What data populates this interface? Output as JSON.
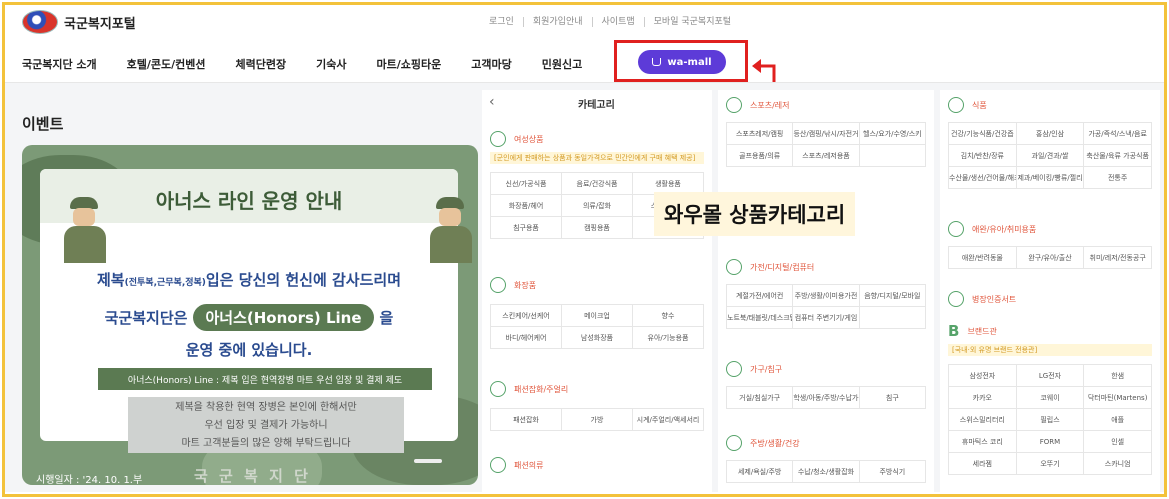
{
  "header": {
    "logo_text": "국군복지포털",
    "utility_links": [
      "로그인",
      "회원가입안내",
      "사이트맵",
      "모바일 국군복지포털"
    ]
  },
  "nav": {
    "items": [
      "국군복지단 소개",
      "호텔/콘도/컨벤션",
      "체력단련장",
      "기숙사",
      "마트/쇼핑타운",
      "고객마당",
      "민원신고"
    ],
    "wamall_label": "wa-mall"
  },
  "event": {
    "title": "이벤트",
    "banner": {
      "heading": "아너스 라인 운영 안내",
      "line1_a": "제복",
      "line1_small": "(전투복,근무복,정복)",
      "line1_b": "입은 당신의 헌신에 감사드리며",
      "line2_a": "국군복지단은",
      "honors": "아너스(Honors) Line",
      "line2_b": "을",
      "line3": "운영 중에 있습니다.",
      "bar": "아너스(Honors) Line : 제복 입은 현역장병 마트 우선 입장 및 결제 제도",
      "note1": "제복을 착용한 현역 장병은 본인에 한해서만",
      "note2": "우선 입장 및 결제가 가능하니",
      "note3": "마트 고객분들의 많은 양해 부탁드립니다",
      "date": "시행일자 : '24. 10. 1.부",
      "org": "국 군 복 지 단"
    }
  },
  "category_panel": {
    "title": "카테고리",
    "sections": [
      {
        "title": "여성상품",
        "sub": "[군인에게 판매하는 상품과 동일가격으로 민간인에게 구매 혜택 제공]",
        "items": [
          "신선/가공식품",
          "음료/건강식품",
          "생활용품",
          "화장품/헤어",
          "의류/잡화",
          "스포츠/레저",
          "침구용품",
          "캠핑용품"
        ]
      },
      {
        "title": "화장품",
        "items": [
          "스킨케어/선케어",
          "메이크업",
          "향수",
          "바디/헤어케어",
          "남성화장품",
          "유아/기능용품"
        ]
      },
      {
        "title": "패션잡화/주얼리",
        "items": [
          "패션잡화",
          "가방",
          "시계/주얼리/액세서리"
        ]
      },
      {
        "title": "패션의류",
        "items": []
      }
    ]
  },
  "category_panel_2": {
    "sections": [
      {
        "title": "스포츠/레저",
        "items": [
          "스포츠레저/캠핑",
          "등산/캠핑/낚시/자전거",
          "헬스/요가/수영/스키",
          "골프용품/의류",
          "스포츠/레저용품"
        ]
      },
      {
        "title": "가전/디지털/컴퓨터",
        "items": [
          "계절가전/에어컨",
          "주방/생활/이미용가전",
          "음향/디지털/모바일",
          "노트북/태블릿/데스크탑",
          "컴퓨터 주변기기/게임"
        ]
      },
      {
        "title": "가구/침구",
        "items": [
          "거실/침실가구",
          "학생/아동/주방/수납가구",
          "침구"
        ]
      },
      {
        "title": "주방/생활/건강",
        "items": [
          "세제/욕실/주방",
          "수납/청소/생활잡화",
          "주방식기"
        ]
      }
    ]
  },
  "category_panel_3": {
    "sections": [
      {
        "title": "식품",
        "items": [
          "건강/기능식품/건강즙",
          "홍삼/인삼",
          "가공/즉석/스낵/음료",
          "김치/반찬/장류",
          "과일/견과/쌀",
          "축산물/육류 가공식품",
          "수산물/생선/건어물/해조류",
          "제과/베이킹/빵류/젤리",
          "전통주"
        ]
      },
      {
        "title": "애완/유아/취미용품",
        "items": [
          "애완/반려동물",
          "완구/유아/출산",
          "취미/레저/전동공구"
        ]
      },
      {
        "title": "병장인증서트",
        "items": []
      },
      {
        "title": "브랜드관",
        "sub": "[국내·외 유명 브랜드 전용관]",
        "items": [
          "삼성전자",
          "LG전자",
          "한샘",
          "카카오",
          "코웨이",
          "닥터마틴(Martens)",
          "스위스밀리터리",
          "필립스",
          "애플",
          "휴마틱스 코리",
          "FORM",
          "인셀",
          "세라젬",
          "오뚜기",
          "스카니엄"
        ]
      }
    ]
  },
  "annotation": {
    "label": "와우몰 상품카테고리",
    "frame_color": "#f3c23b",
    "highlight_color": "#e0201f"
  }
}
